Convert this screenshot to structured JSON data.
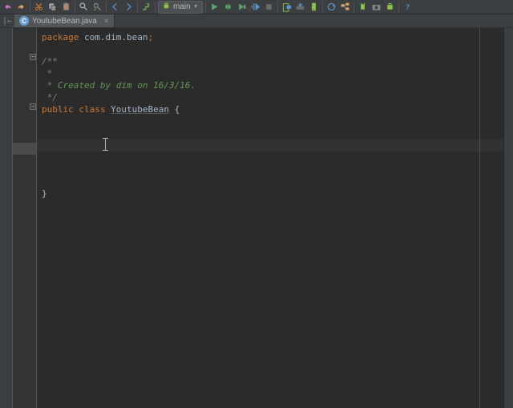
{
  "toolbar": {
    "run_config": "main"
  },
  "tab": {
    "filename": "YoutubeBean.java",
    "icon_letter": "C"
  },
  "code": {
    "l1_kw": "package",
    "l1_pkg": " com.dim.bean",
    "l1_semi": ";",
    "l2": "",
    "l3": "/**",
    "l4": " *",
    "l5": " * Created by dim on 16/3/16.",
    "l6": " */",
    "l7_kw1": "public",
    "l7_sp1": " ",
    "l7_kw2": "class",
    "l7_sp2": " ",
    "l7_name": "YoutubeBean",
    "l7_brace": " {",
    "l8": "",
    "l_close": "}"
  }
}
